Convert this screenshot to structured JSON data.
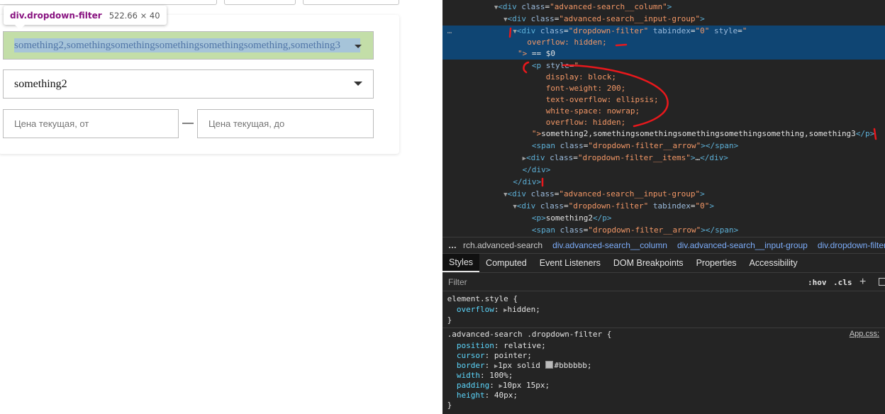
{
  "tooltip": {
    "element_name": "div.dropdown-filter",
    "size": "522.66 × 40"
  },
  "dropdowns": [
    {
      "value": "something2,somethingsomethingsomethingsomethingsomething,something3"
    },
    {
      "value": "something2"
    }
  ],
  "price": {
    "from_placeholder": "Цена текущая, от",
    "separator": "—",
    "to_placeholder": "Цена текущая, до"
  },
  "elements": {
    "l0": {
      "tag_open": "<div ",
      "attr": "class",
      "val": "\"advanced-search__column\"",
      "close": ">"
    },
    "l1": {
      "tag_open": "<div ",
      "attr": "class",
      "val": "\"advanced-search__input-group\"",
      "close": ">"
    },
    "l2": {
      "tag_open": "<div ",
      "attr1": "class",
      "val1": "\"dropdown-filter\"",
      "attr2": "tabindex",
      "val2": "\"0\"",
      "attr3": "style",
      "val3": "\""
    },
    "l3": {
      "text": "overflow: hidden;"
    },
    "l4": {
      "close": "\">",
      "eq": " == $0"
    },
    "l5": {
      "tag_open": "<p ",
      "attr": "style",
      "val": "\""
    },
    "l6": {
      "text": "display: block;"
    },
    "l7": {
      "text": "font-weight: 200;"
    },
    "l8": {
      "text": "text-overflow: ellipsis;"
    },
    "l9": {
      "text": "white-space: nowrap;"
    },
    "l10": {
      "text": "overflow: hidden;"
    },
    "l11": {
      "close": "\">",
      "text": "something2,somethingsomethingsomethingsomethingsomething,something3",
      "end": "</p>"
    },
    "l12": {
      "tag_open": "<span ",
      "attr": "class",
      "val": "\"dropdown-filter__arrow\"",
      "close": "></span>"
    },
    "l13": {
      "tag_open": "<div ",
      "attr": "class",
      "val": "\"dropdown-filter__items\"",
      "close": ">",
      "ellipsis": "…",
      "end": "</div>"
    },
    "l14": {
      "text": "</div>"
    },
    "l15": {
      "text": "</div>"
    },
    "l16": {
      "tag_open": "<div ",
      "attr": "class",
      "val": "\"advanced-search__input-group\"",
      "close": ">"
    },
    "l17": {
      "tag_open": "<div ",
      "attr1": "class",
      "val1": "\"dropdown-filter\"",
      "attr2": "tabindex",
      "val2": "\"0\"",
      "close": ">"
    },
    "l18": {
      "open": "<p>",
      "text": "something2",
      "end": "</p>"
    },
    "l19": {
      "tag_open": "<span ",
      "attr": "class",
      "val": "\"dropdown-filter__arrow\"",
      "close": "></span>"
    },
    "row_dots": "…"
  },
  "breadcrumbs": [
    "…",
    "rch.advanced-search",
    "div.advanced-search__column",
    "div.advanced-search__input-group",
    "div.dropdown-filter"
  ],
  "tabs": [
    "Styles",
    "Computed",
    "Event Listeners",
    "DOM Breakpoints",
    "Properties",
    "Accessibility"
  ],
  "filter": {
    "placeholder": "Filter",
    "hov": ":hov",
    "cls": ".cls",
    "plus": "+"
  },
  "styles": {
    "element_style": {
      "selector": "element.style {",
      "prop": "overflow",
      "value": "hidden;",
      "close": "}"
    },
    "rule": {
      "selector": ".advanced-search .dropdown-filter {",
      "source": "App.css:",
      "props": [
        {
          "name": "position",
          "value": "relative;"
        },
        {
          "name": "cursor",
          "value": "pointer;"
        },
        {
          "name": "border",
          "value": "1px solid ",
          "color": "#bbbbbb",
          "suffix": "#bbbbbb;"
        },
        {
          "name": "width",
          "value": "100%;"
        },
        {
          "name": "padding",
          "value": "10px 15px;"
        },
        {
          "name": "height",
          "value": "40px;"
        }
      ],
      "close": "}"
    }
  },
  "colors": {
    "annotation": "#e8181c",
    "selected_row": "#0f4573",
    "highlight_content": "#a6c4d9",
    "highlight_padding": "#c3dea8"
  }
}
